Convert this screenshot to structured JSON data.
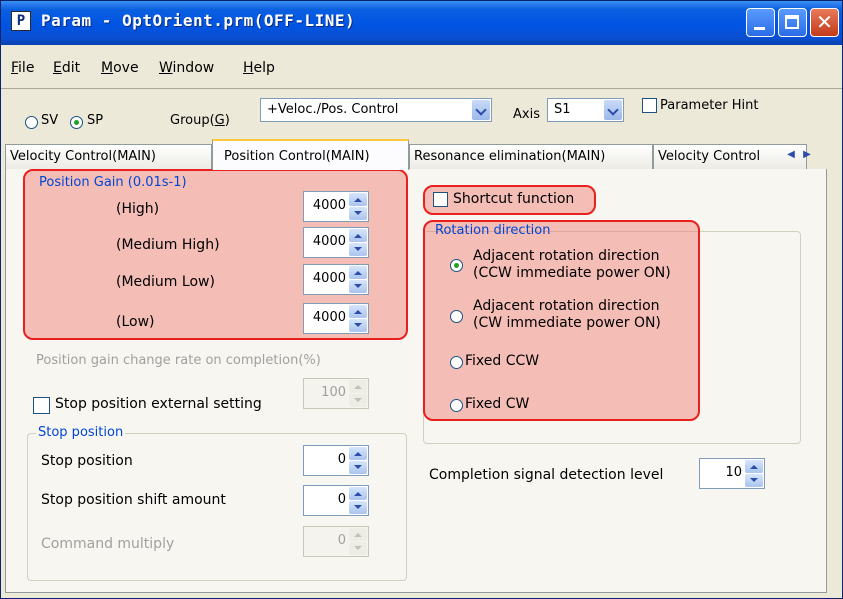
{
  "window": {
    "title": "Param - OptOrient.prm(OFF-LINE)",
    "icon_letter": "P"
  },
  "menu": {
    "file": {
      "label": "File",
      "hotkey": "F",
      "rest": "ile"
    },
    "edit": {
      "label": "Edit",
      "hotkey": "E",
      "rest": "dit"
    },
    "move": {
      "label": "Move",
      "hotkey": "M",
      "rest": "ove"
    },
    "window": {
      "label": "Window",
      "hotkey": "W",
      "rest": "indow"
    },
    "help": {
      "label": "Help",
      "hotkey": "H",
      "rest": "elp"
    }
  },
  "toolbar": {
    "sv_label": "SV",
    "sp_label": "SP",
    "selected_mode": "SP",
    "group_label": "Group(",
    "group_hotkey": "G",
    "group_close": ")",
    "group_value": "+Veloc./Pos. Control",
    "axis_label": "Axis",
    "axis_value": "S1",
    "param_hint_label": "Parameter Hint"
  },
  "tabs": [
    {
      "label": "Velocity Control(MAIN)",
      "active": false
    },
    {
      "label": "Position Control(MAIN)",
      "active": true
    },
    {
      "label": "Resonance elimination(MAIN)",
      "active": false
    },
    {
      "label": "Velocity Control",
      "active": false
    }
  ],
  "position_gain": {
    "title": "Position Gain (0.01s-1)",
    "rows": [
      {
        "label": "(High)",
        "value": "4000"
      },
      {
        "label": "(Medium High)",
        "value": "4000"
      },
      {
        "label": "(Medium Low)",
        "value": "4000"
      },
      {
        "label": "(Low)",
        "value": "4000"
      }
    ]
  },
  "gain_change": {
    "label": "Position gain change rate on completion(%)",
    "value": "100"
  },
  "stop_external": {
    "label": "Stop position external setting"
  },
  "stop_position_group": {
    "title": "Stop position",
    "rows": [
      {
        "label": "Stop position",
        "value": "0",
        "enabled": true
      },
      {
        "label": "Stop position shift amount",
        "value": "0",
        "enabled": true
      },
      {
        "label": "Command multiply",
        "value": "0",
        "enabled": false
      }
    ]
  },
  "shortcut": {
    "label": "Shortcut function",
    "checked": false
  },
  "rotation": {
    "title": "Rotation direction",
    "options": [
      {
        "line1": "Adjacent rotation direction",
        "line2": "(CCW immediate power ON)",
        "selected": true
      },
      {
        "line1": "Adjacent rotation direction",
        "line2": "(CW immediate power ON)",
        "selected": false
      },
      {
        "line1": "Fixed CCW",
        "line2": "",
        "selected": false
      },
      {
        "line1": "Fixed CW",
        "line2": "",
        "selected": false
      }
    ]
  },
  "completion": {
    "label": "Completion signal detection level",
    "value": "10"
  },
  "colors": {
    "titlebar": "#0054e3",
    "highlight_border": "#e8201f",
    "highlight_fill": "#f0786e",
    "group_title": "#0046d5"
  }
}
